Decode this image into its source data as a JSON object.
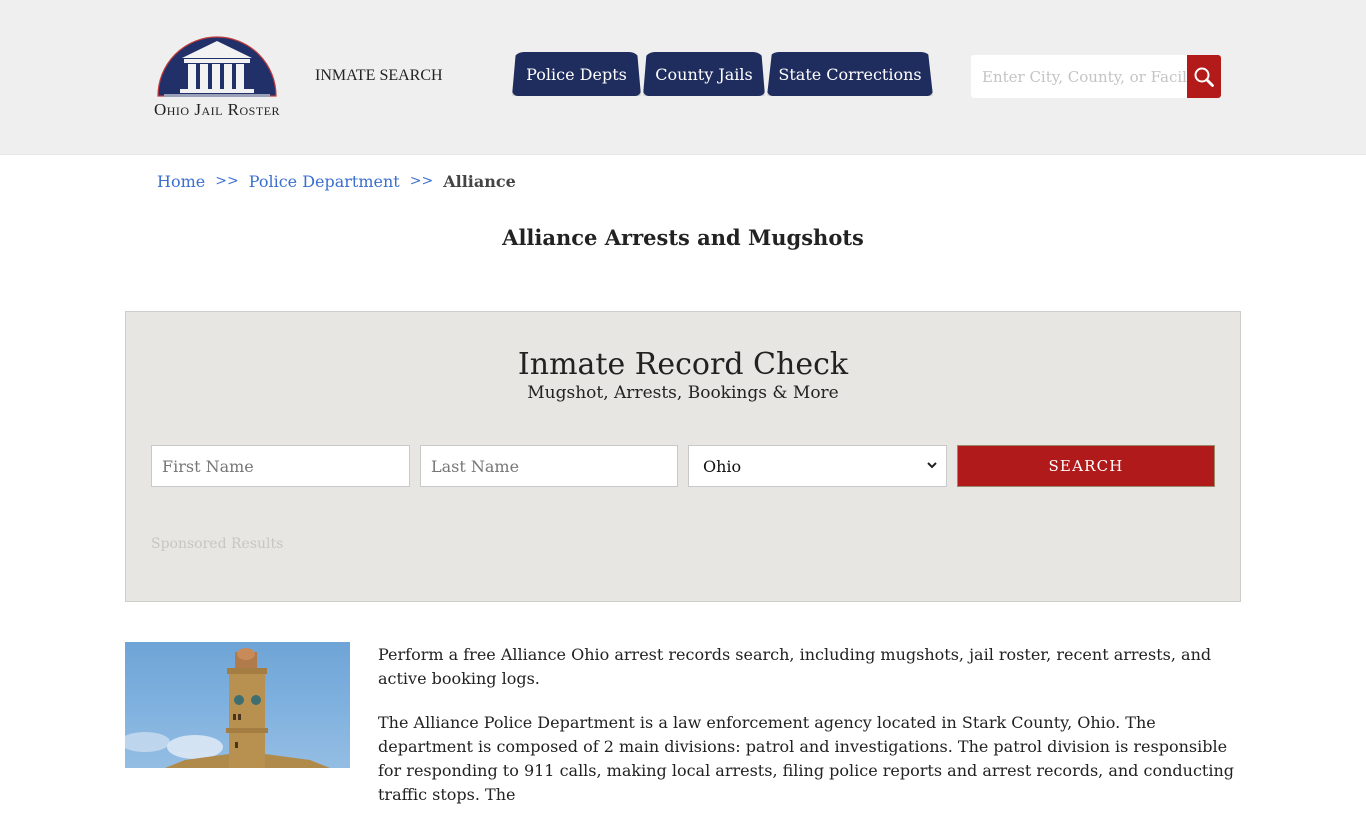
{
  "header": {
    "logo_text": "Ohio Jail Roster",
    "inmate_search_link": "INMATE SEARCH",
    "nav_tabs": [
      {
        "label": "Police Depts"
      },
      {
        "label": "County Jails"
      },
      {
        "label": "State Corrections"
      }
    ],
    "search": {
      "placeholder": "Enter City, County, or Facility",
      "value": "",
      "button_icon": "search-icon"
    }
  },
  "breadcrumb": {
    "items": [
      {
        "label": "Home"
      },
      {
        "label": "Police Department"
      }
    ],
    "separator": ">>",
    "current": "Alliance"
  },
  "page_title": "Alliance Arrests and Mugshots",
  "record_check": {
    "title": "Inmate Record Check",
    "subtitle": "Mugshot, Arrests, Bookings & More",
    "first_name_placeholder": "First Name",
    "last_name_placeholder": "Last Name",
    "state_selected": "Ohio",
    "search_button": "SEARCH",
    "sponsored_label": "Sponsored Results"
  },
  "content": {
    "image_alt": "Alliance clock tower building",
    "paragraphs": [
      "Perform a free Alliance Ohio arrest records search, including mugshots, jail roster, recent arrests, and active booking logs.",
      "The Alliance Police Department is a law enforcement agency located in Stark County, Ohio. The department is composed of 2 main divisions: patrol and investigations. The patrol division is responsible for responding to 911 calls, making local arrests, filing police reports and arrest records, and conducting traffic stops. The"
    ]
  },
  "colors": {
    "nav_blue": "#1f2c5e",
    "accent_red": "#b01a1a",
    "link_blue": "#3a6fd0",
    "header_bg": "#efefef",
    "box_bg": "#e8e6e2"
  }
}
